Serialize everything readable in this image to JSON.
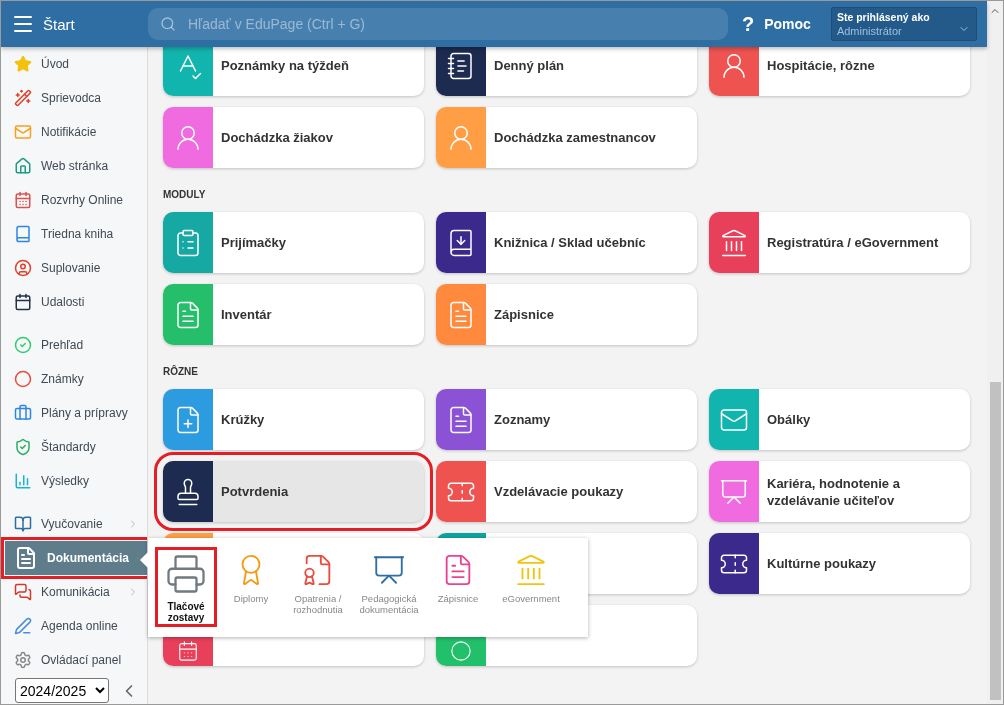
{
  "header": {
    "menu_label": "Štart",
    "search": {
      "placeholder": "Hľadať v EduPage (Ctrl + G)"
    },
    "help": {
      "icon": "?",
      "label": "Pomoc"
    },
    "user": {
      "caption": "Ste prihlásený ako",
      "role": "Administrátor"
    }
  },
  "sidebar": {
    "groups": [
      {
        "items": [
          {
            "label": "Úvod",
            "selected": false,
            "submenu": false
          },
          {
            "label": "Sprievodca",
            "selected": false,
            "submenu": false
          },
          {
            "label": "Notifikácie",
            "selected": false,
            "submenu": false
          },
          {
            "label": "Web stránka",
            "selected": false,
            "submenu": false
          },
          {
            "label": "Rozvrhy Online",
            "selected": false,
            "submenu": false
          },
          {
            "label": "Triedna kniha",
            "selected": false,
            "submenu": false
          },
          {
            "label": "Suplovanie",
            "selected": false,
            "submenu": false
          },
          {
            "label": "Udalosti",
            "selected": false,
            "submenu": false
          }
        ]
      },
      {
        "items": [
          {
            "label": "Prehľad",
            "selected": false,
            "submenu": false
          },
          {
            "label": "Známky",
            "selected": false,
            "submenu": false
          },
          {
            "label": "Plány a prípravy",
            "selected": false,
            "submenu": false
          },
          {
            "label": "Štandardy",
            "selected": false,
            "submenu": false
          },
          {
            "label": "Výsledky",
            "selected": false,
            "submenu": false
          }
        ]
      },
      {
        "items": [
          {
            "label": "Vyučovanie",
            "selected": false,
            "submenu": true
          },
          {
            "label": "Dokumentácia",
            "selected": true,
            "submenu": true
          },
          {
            "label": "Komunikácia",
            "selected": false,
            "submenu": true
          },
          {
            "label": "Agenda online",
            "selected": false,
            "submenu": false
          },
          {
            "label": "Ovládací panel",
            "selected": false,
            "submenu": false
          }
        ]
      }
    ],
    "year_select": {
      "value": "2024/2025"
    }
  },
  "sections": [
    {
      "tiles": [
        {
          "label": "Poznámky na týždeň",
          "color": "#12b5ad",
          "selected": false
        },
        {
          "label": "Denný plán",
          "color": "#1d2b50",
          "selected": false
        },
        {
          "label": "Hospitácie, rôzne",
          "color": "#ef5350",
          "selected": false
        },
        {
          "label": "Dochádzka žiakov",
          "color": "#f06ae0",
          "selected": false
        },
        {
          "label": "Dochádzka zamestnancov",
          "color": "#ff9e45",
          "selected": false
        }
      ]
    },
    {
      "heading": "MODULY",
      "tiles": [
        {
          "label": "Prijímačky",
          "color": "#16a8a3",
          "selected": false
        },
        {
          "label": "Knižnica / Sklad učebníc",
          "color": "#3b2a8c",
          "selected": false
        },
        {
          "label": "Registratúra / eGovernment",
          "color": "#e8405a",
          "selected": false
        },
        {
          "label": "Inventár",
          "color": "#25bf6b",
          "selected": false
        },
        {
          "label": "Zápisnice",
          "color": "#ff8a3d",
          "selected": false
        }
      ]
    },
    {
      "heading": "RÔZNE",
      "tiles": [
        {
          "label": "Krúžky",
          "color": "#2d9be0",
          "selected": false
        },
        {
          "label": "Zoznamy",
          "color": "#8b52d6",
          "selected": false
        },
        {
          "label": "Obálky",
          "color": "#12b5ad",
          "selected": false
        },
        {
          "label": "Potvrdenia",
          "color": "#1d2b50",
          "selected": true
        },
        {
          "label": "Vzdelávacie poukazy",
          "color": "#ef5350",
          "selected": false
        },
        {
          "label": "Kariéra, hodnotenie a vzdelávanie učiteľov",
          "color": "#f06ae0",
          "selected": false
        },
        {
          "color": "#ff9e45",
          "selected": false
        },
        {
          "color": "#0fa3a0",
          "selected": false
        },
        {
          "label": "Kultúrne poukazy",
          "color": "#3b2a8c",
          "selected": false
        },
        {
          "color": "#e8405a",
          "selected": false
        },
        {
          "color": "#22c06b",
          "selected": false
        }
      ]
    }
  ],
  "submenu": {
    "items": [
      {
        "label": "Tlačové zostavy",
        "selected": true
      },
      {
        "label": "Diplomy",
        "selected": false
      },
      {
        "label": "Opatrenia / rozhodnutia",
        "selected": false
      },
      {
        "label": "Pedagogická dokumentácia",
        "selected": false
      },
      {
        "label": "Zápisnice",
        "selected": false
      },
      {
        "label": "eGovernment",
        "selected": false
      }
    ]
  }
}
